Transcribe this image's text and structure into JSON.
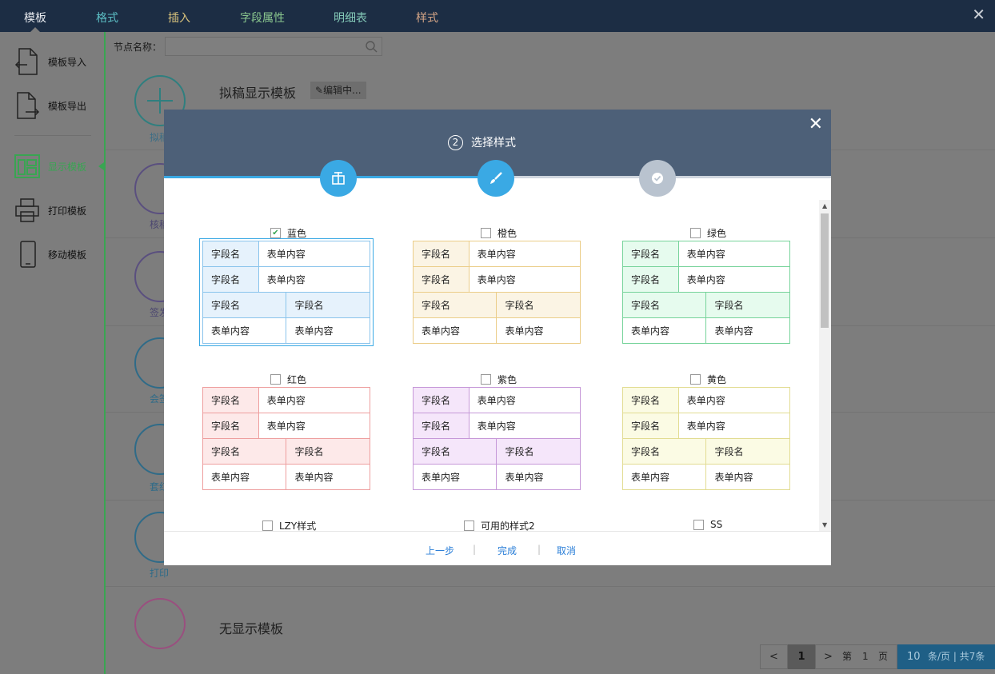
{
  "topbar": {
    "tabs": [
      {
        "label": "模板",
        "color": "#e6e9ee"
      },
      {
        "label": "格式",
        "color": "#5dc0c6"
      },
      {
        "label": "插入",
        "color": "#d8c27c"
      },
      {
        "label": "字段属性",
        "color": "#8bc88f"
      },
      {
        "label": "明细表",
        "color": "#84c9b8"
      },
      {
        "label": "样式",
        "color": "#d6a687"
      }
    ],
    "close": "✕"
  },
  "sidebar": {
    "items": [
      {
        "label": "模板导入"
      },
      {
        "label": "模板导出"
      },
      {
        "label": "显示模板"
      },
      {
        "label": "打印模板"
      },
      {
        "label": "移动模板"
      }
    ]
  },
  "search": {
    "label": "节点名称："
  },
  "list": {
    "row1_title": "拟稿显示模板",
    "row1_badge": "编辑中...",
    "row1_caption": "拟稿",
    "row2_caption": "核稿",
    "row3_caption": "签发",
    "row4_caption": "会签",
    "row5_caption": "套红",
    "row6_caption": "打印",
    "last_title": "无显示模板"
  },
  "modal": {
    "step_num": "2",
    "title": "选择样式",
    "close": "✕"
  },
  "styles": [
    {
      "name": "蓝色",
      "checked": true,
      "border": "#8ac4ec",
      "fill": "#e6f2fc"
    },
    {
      "name": "橙色",
      "checked": false,
      "border": "#ebcd89",
      "fill": "#fbf4e4"
    },
    {
      "name": "绿色",
      "checked": false,
      "border": "#76d39a",
      "fill": "#e6fbee"
    },
    {
      "name": "红色",
      "checked": false,
      "border": "#ee9f9f",
      "fill": "#fde9e9"
    },
    {
      "name": "紫色",
      "checked": false,
      "border": "#c698d8",
      "fill": "#f5e6fa"
    },
    {
      "name": "黄色",
      "checked": false,
      "border": "#e2dc92",
      "fill": "#fbfbe4"
    }
  ],
  "more_styles": [
    "LZY样式",
    "可用的样式2",
    "SS"
  ],
  "table_text": {
    "field": "字段名",
    "content": "表单内容"
  },
  "footer": {
    "prev": "上一步",
    "done": "完成",
    "cancel": "取消",
    "sep": "|"
  },
  "pager": {
    "prev": "<",
    "page": "1",
    "next": ">",
    "di": "第",
    "cur": "1",
    "ye": "页",
    "size": "10",
    "info": "条/页 | 共7条"
  }
}
